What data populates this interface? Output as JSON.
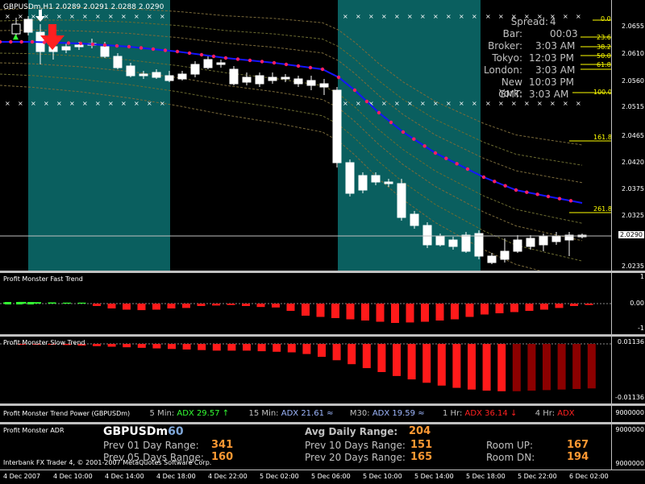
{
  "symbol_header": "GBPUSDm,H1  2.0289 2.0291 2.0288 2.0290",
  "price_scale": [
    "2.0655",
    "2.0610",
    "2.0560",
    "2.0515",
    "2.0465",
    "2.0420",
    "2.0375",
    "2.0325",
    "2.0290",
    "2.0235"
  ],
  "current_price": "2.0290",
  "info_panel": {
    "spread_label": "Spread:",
    "spread_value": "4",
    "bar_label": "Bar:",
    "bar_value": "00:03",
    "broker_label": "Broker:",
    "broker_value": "3:03 AM",
    "tokyo_label": "Tokyo:",
    "tokyo_value": "12:03 PM",
    "london_label": "London:",
    "london_value": "3:03 AM",
    "newyork_label": "New York:",
    "newyork_value": "10:03 PM",
    "gmt_label": "GMT:",
    "gmt_value": "3:03 AM"
  },
  "fib_levels": [
    "0.0",
    "23.6",
    "38.2",
    "50.0",
    "61.8",
    "100.0",
    "161.8",
    "261.8"
  ],
  "fast_trend": {
    "title": "Profit Monster Fast Trend",
    "scale": [
      "1",
      "0.00",
      "-1"
    ],
    "bars": [
      0.05,
      0.07,
      0.06,
      0.05,
      0.04,
      0.04,
      -0.1,
      -0.2,
      -0.25,
      -0.27,
      -0.25,
      -0.2,
      -0.18,
      -0.1,
      -0.08,
      -0.06,
      -0.1,
      -0.14,
      -0.16,
      -0.3,
      -0.5,
      -0.55,
      -0.6,
      -0.65,
      -0.7,
      -0.75,
      -0.8,
      -0.78,
      -0.75,
      -0.7,
      -0.65,
      -0.55,
      -0.45,
      -0.4,
      -0.35,
      -0.3,
      -0.25,
      -0.18,
      -0.1,
      -0.06
    ]
  },
  "slow_trend": {
    "title": "Profit Monster Slow Trend",
    "scale": [
      "0.01136",
      "-0.01136"
    ],
    "bars": [
      0.01,
      0.01,
      0.01,
      0.02,
      0.03,
      0.04,
      0.05,
      0.06,
      0.07,
      0.08,
      0.09,
      0.1,
      0.11,
      0.12,
      0.12,
      0.12,
      0.13,
      0.14,
      0.15,
      0.18,
      0.23,
      0.29,
      0.36,
      0.43,
      0.5,
      0.57,
      0.63,
      0.69,
      0.74,
      0.78,
      0.81,
      0.83,
      0.84,
      0.84,
      0.83,
      0.82,
      0.81,
      0.8,
      0.79
    ],
    "dark_from": 33
  },
  "trend_power": {
    "title": "Profit Monster Trend Power (GBPUSDm)",
    "m5_label": "5 Min:",
    "m5_value": "ADX 29.57",
    "m5_arrow": "↑",
    "m15_label": "15 Min:",
    "m15_value": "ADX 21.61",
    "m15_arrow": "≈",
    "m30_label": "M30:",
    "m30_value": "ADX 19.59",
    "m30_arrow": "≈",
    "h1_label": "1 Hr:",
    "h1_value": "ADX 36.14",
    "h1_arrow": "↓",
    "h4_label": "4 Hr:",
    "h4_value": "ADX"
  },
  "adr": {
    "title": "Profit Monster ADR",
    "symbol": "GBPUSDm",
    "tf": "60",
    "prev01_label": "Prev 01 Day Range:",
    "prev01_value": "341",
    "prev05_label": "Prev 05 Days Range:",
    "prev05_value": "160",
    "avg_label": "Avg Daily Range:",
    "avg_value": "204",
    "prev10_label": "Prev 10 Days Range:",
    "prev10_value": "151",
    "prev20_label": "Prev 20 Days Range:",
    "prev20_value": "165",
    "roomup_label": "Room UP:",
    "roomup_value": "167",
    "roomdn_label": "Room DN:",
    "roomdn_value": "194",
    "scale_top": "9000000",
    "scale_bottom": "9000000",
    "copyright": "Interbank FX Trader 4, © 2001-2007 MetaQuotes Software Corp."
  },
  "trend_scale": [
    "9000000"
  ],
  "time_axis": [
    "4 Dec 2007",
    "4 Dec 10:00",
    "4 Dec 14:00",
    "4 Dec 18:00",
    "4 Dec 22:00",
    "5 Dec 02:00",
    "5 Dec 06:00",
    "5 Dec 10:00",
    "5 Dec 14:00",
    "5 Dec 18:00",
    "5 Dec 22:00",
    "6 Dec 02:00"
  ],
  "colors": {
    "session": "#0a5f5f",
    "ma": "#1515ff",
    "bull": "#33ff33",
    "bear": "#ff1a1a",
    "dark_bear": "#8b0000"
  }
}
